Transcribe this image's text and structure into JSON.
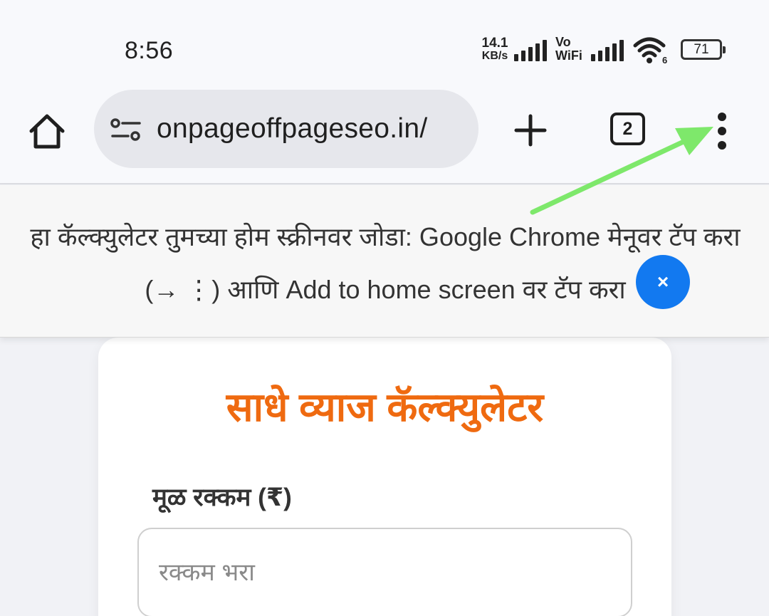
{
  "status_bar": {
    "time": "8:56",
    "net_speed_value": "14.1",
    "net_speed_unit": "KB/s",
    "vowifi_line1": "Vo",
    "vowifi_line2": "WiFi",
    "wifi_badge": "6",
    "battery": "71"
  },
  "browser": {
    "url": "onpageoffpageseo.in/",
    "tab_count": "2"
  },
  "notice": {
    "message": "हा कॅल्क्युलेटर तुमच्या होम स्क्रीनवर जोडा: Google Chrome मेनूवर टॅप करा (→ ⋮) आणि Add to home screen वर टॅप करा",
    "close_label": "×",
    "accent_color": "#1279f0"
  },
  "calculator": {
    "title": "साधे व्याज कॅल्क्युलेटर",
    "title_color": "#ef6a10",
    "amount_label": "मूळ रक्कम (₹)",
    "amount_placeholder": "रक्कम भरा",
    "amount_value": ""
  },
  "annotation": {
    "arrow_color": "#7ee86b"
  }
}
